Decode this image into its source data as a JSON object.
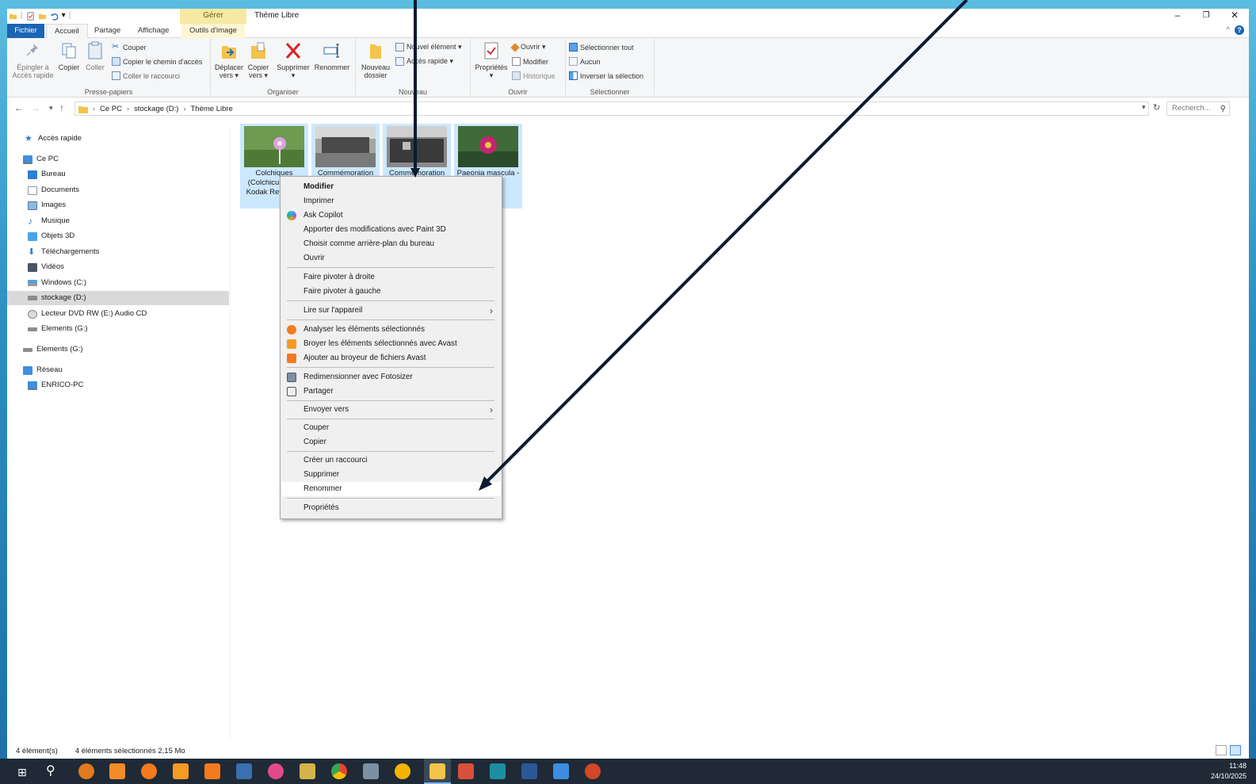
{
  "window": {
    "manage_tab": "Gérer",
    "title": "Thème Libre",
    "min": "–",
    "max": "❐",
    "close": "✕"
  },
  "tabs": {
    "file": "Fichier",
    "home": "Accueil",
    "share": "Partage",
    "view": "Affichage",
    "image_tools": "Outils d'image"
  },
  "ribbon": {
    "clipboard": {
      "name": "Presse-papiers",
      "pin": "Épingler à Accès rapide",
      "copy": "Copier",
      "paste": "Coller",
      "cut": "Couper",
      "copy_path": "Copier le chemin d'accès",
      "paste_shortcut": "Coller le raccourci"
    },
    "organize": {
      "name": "Organiser",
      "move_to": "Déplacer vers ▾",
      "copy_to": "Copier vers ▾",
      "delete": "Supprimer",
      "rename": "Renommer"
    },
    "new": {
      "name": "Nouveau",
      "new_folder": "Nouveau dossier",
      "new_item": "Nouvel élément ▾",
      "easy_access": "Accès rapide ▾"
    },
    "open": {
      "name": "Ouvrir",
      "properties": "Propriétés",
      "open": "Ouvrir ▾",
      "edit": "Modifier",
      "history": "Historique"
    },
    "select": {
      "name": "Sélectionner",
      "select_all": "Sélectionner tout",
      "select_none": "Aucun",
      "invert": "Inverser la sélection"
    }
  },
  "address": {
    "crumbs": [
      "Ce PC",
      "stockage (D:)",
      "Thème Libre"
    ],
    "search_placeholder": "Recherch..."
  },
  "nav": {
    "quick_access": "Accès rapide",
    "this_pc": "Ce PC",
    "desktop": "Bureau",
    "documents": "Documents",
    "pictures": "Images",
    "music": "Musique",
    "objects3d": "Objets 3D",
    "downloads": "Téléchargements",
    "videos": "Vidéos",
    "drive_c": "Windows (C:)",
    "drive_d": "stockage (D:)",
    "drive_e": "Lecteur DVD RW (E:) Audio CD",
    "drive_g1": "Elements (G:)",
    "drive_g2": "Elements (G:)",
    "network": "Réseau",
    "enrico_pc": "ENRICO-PC"
  },
  "files": [
    {
      "caption": "Colchiques (Colchicum 42 - Kodak Retinar s-"
    },
    {
      "caption": "Commémoration"
    },
    {
      "caption": "Commémoration"
    },
    {
      "caption": "Paeonia mascula - 135 f 8"
    }
  ],
  "context_menu": {
    "edit": "Modifier",
    "print": "Imprimer",
    "copilot": "Ask Copilot",
    "paint3d": "Apporter des modifications avec Paint 3D",
    "wallpaper": "Choisir comme arrière-plan du bureau",
    "open": "Ouvrir",
    "rotate_right": "Faire pivoter à droite",
    "rotate_left": "Faire pivoter à gauche",
    "cast": "Lire sur l'appareil",
    "avast_scan": "Analyser les éléments sélectionnés",
    "avast_shred": "Broyer les éléments sélectionnés avec Avast",
    "avast_add": "Ajouter au broyeur de fichiers Avast",
    "fotosizer": "Redimensionner avec Fotosizer",
    "share": "Partager",
    "send_to": "Envoyer vers",
    "cut": "Couper",
    "copy": "Copier",
    "shortcut": "Créer un raccourci",
    "delete": "Supprimer",
    "rename": "Renommer",
    "properties": "Propriétés"
  },
  "status": {
    "count": "4 élément(s)",
    "selected": "4 éléments sélectionnés  2,15 Mo"
  },
  "taskbar": {
    "time": "11:48",
    "date": "24/10/2025"
  },
  "colors": {
    "accent": "#1a65b4",
    "selection": "#cce8ff",
    "arrow": "#0b1a33"
  }
}
